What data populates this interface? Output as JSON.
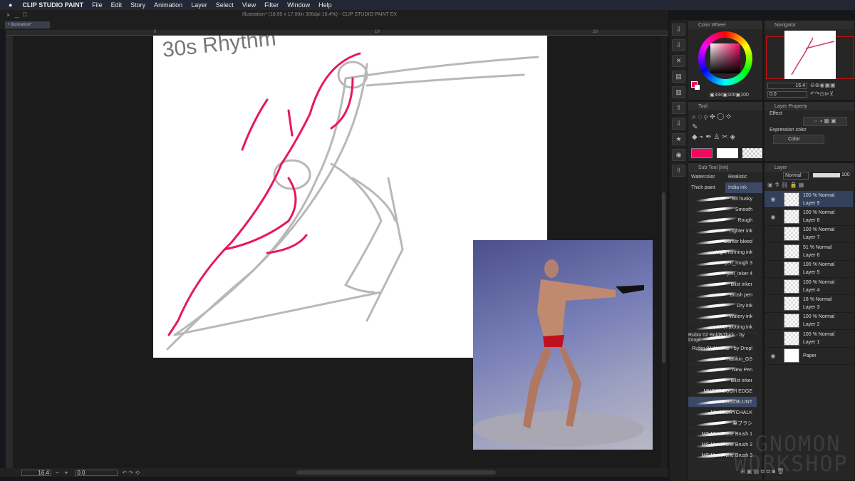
{
  "menubar": {
    "apple": "",
    "app": "CLIP STUDIO PAINT",
    "items": [
      "File",
      "Edit",
      "Story",
      "Animation",
      "Layer",
      "Select",
      "View",
      "Filter",
      "Window",
      "Help"
    ]
  },
  "window": {
    "title": "Illustration* (18.00 x 17.00in 300dpi 16.4%)  - CLIP STUDIO PAINT EX",
    "tab": "Illustration*",
    "controls": [
      "×",
      "_",
      "□"
    ]
  },
  "ruler": {
    "ticks": [
      "0",
      "10",
      "20"
    ]
  },
  "canvas": {
    "sketch_text": "30s Rhythm",
    "accent": "#e8175d"
  },
  "bottom": {
    "zoom": "16.4",
    "angle": "0.0",
    "minus": "−",
    "plus": "+"
  },
  "color_wheel": {
    "title": "Color Wheel",
    "h": "334",
    "s": "100",
    "v": "100",
    "main": "#f4075e",
    "sub": "#ffffff"
  },
  "navigator": {
    "title": "Navigator",
    "zoom": "16.4",
    "angle": "0.0"
  },
  "tool": {
    "title": "Tool",
    "icons": [
      "zoom",
      "rotate",
      "eyedropper-move",
      "move",
      "lasso",
      "magic-wand",
      "eyedropper",
      "fill",
      "eraser",
      "pen",
      "stamp",
      "decoration",
      "blend"
    ]
  },
  "layer_property": {
    "title": "Layer Property",
    "effect_label": "Effect",
    "expression_label": "Expression color",
    "expression_value": "Color"
  },
  "sub_tool": {
    "title": "Sub Tool [Ink]",
    "tabs": [
      "Watercolor",
      "Realistic",
      "Thick paint",
      "India ink"
    ],
    "items": [
      "Bit husky",
      "Smooth",
      "Rough",
      "Lighter ink",
      "Darker bleed",
      "Light running ink",
      "yeti_rough 3",
      "yeti_inker 4",
      "Blist inker",
      "Brush pen",
      "Dry ink",
      "Watery ink",
      "Wet blotting ink",
      "Rubin 02 Bold&Thick - by Dropl",
      "Rubin 01 Natural - by Dropl",
      "Nankin_GS",
      "New Pen",
      "Blist inker",
      "MUGZROUGH EDGE",
      "MUGZBLUNT",
      "MUGZDRYCHALK",
      "筆ブラシ",
      "MS MonoTone Brush 1",
      "MS MonoTone Brush 2",
      "MS MonoTone Brush 3"
    ],
    "selected": 19
  },
  "layer": {
    "title": "Layer",
    "blend": "Normal",
    "opacity": "100",
    "rows": [
      {
        "mode": "100 % Normal",
        "name": "Layer 9"
      },
      {
        "mode": "100 % Normal",
        "name": "Layer 8"
      },
      {
        "mode": "100 % Normal",
        "name": "Layer 7"
      },
      {
        "mode": "51 % Normal",
        "name": "Layer 6"
      },
      {
        "mode": "100 % Normal",
        "name": "Layer 5"
      },
      {
        "mode": "100 % Normal",
        "name": "Layer 4"
      },
      {
        "mode": "18 % Normal",
        "name": "Layer 3"
      },
      {
        "mode": "100 % Normal",
        "name": "Layer 2"
      },
      {
        "mode": "100 % Normal",
        "name": "Layer 1"
      }
    ],
    "paper": "Paper"
  },
  "watermark": [
    "GNOMON",
    "WORKSHOP"
  ]
}
